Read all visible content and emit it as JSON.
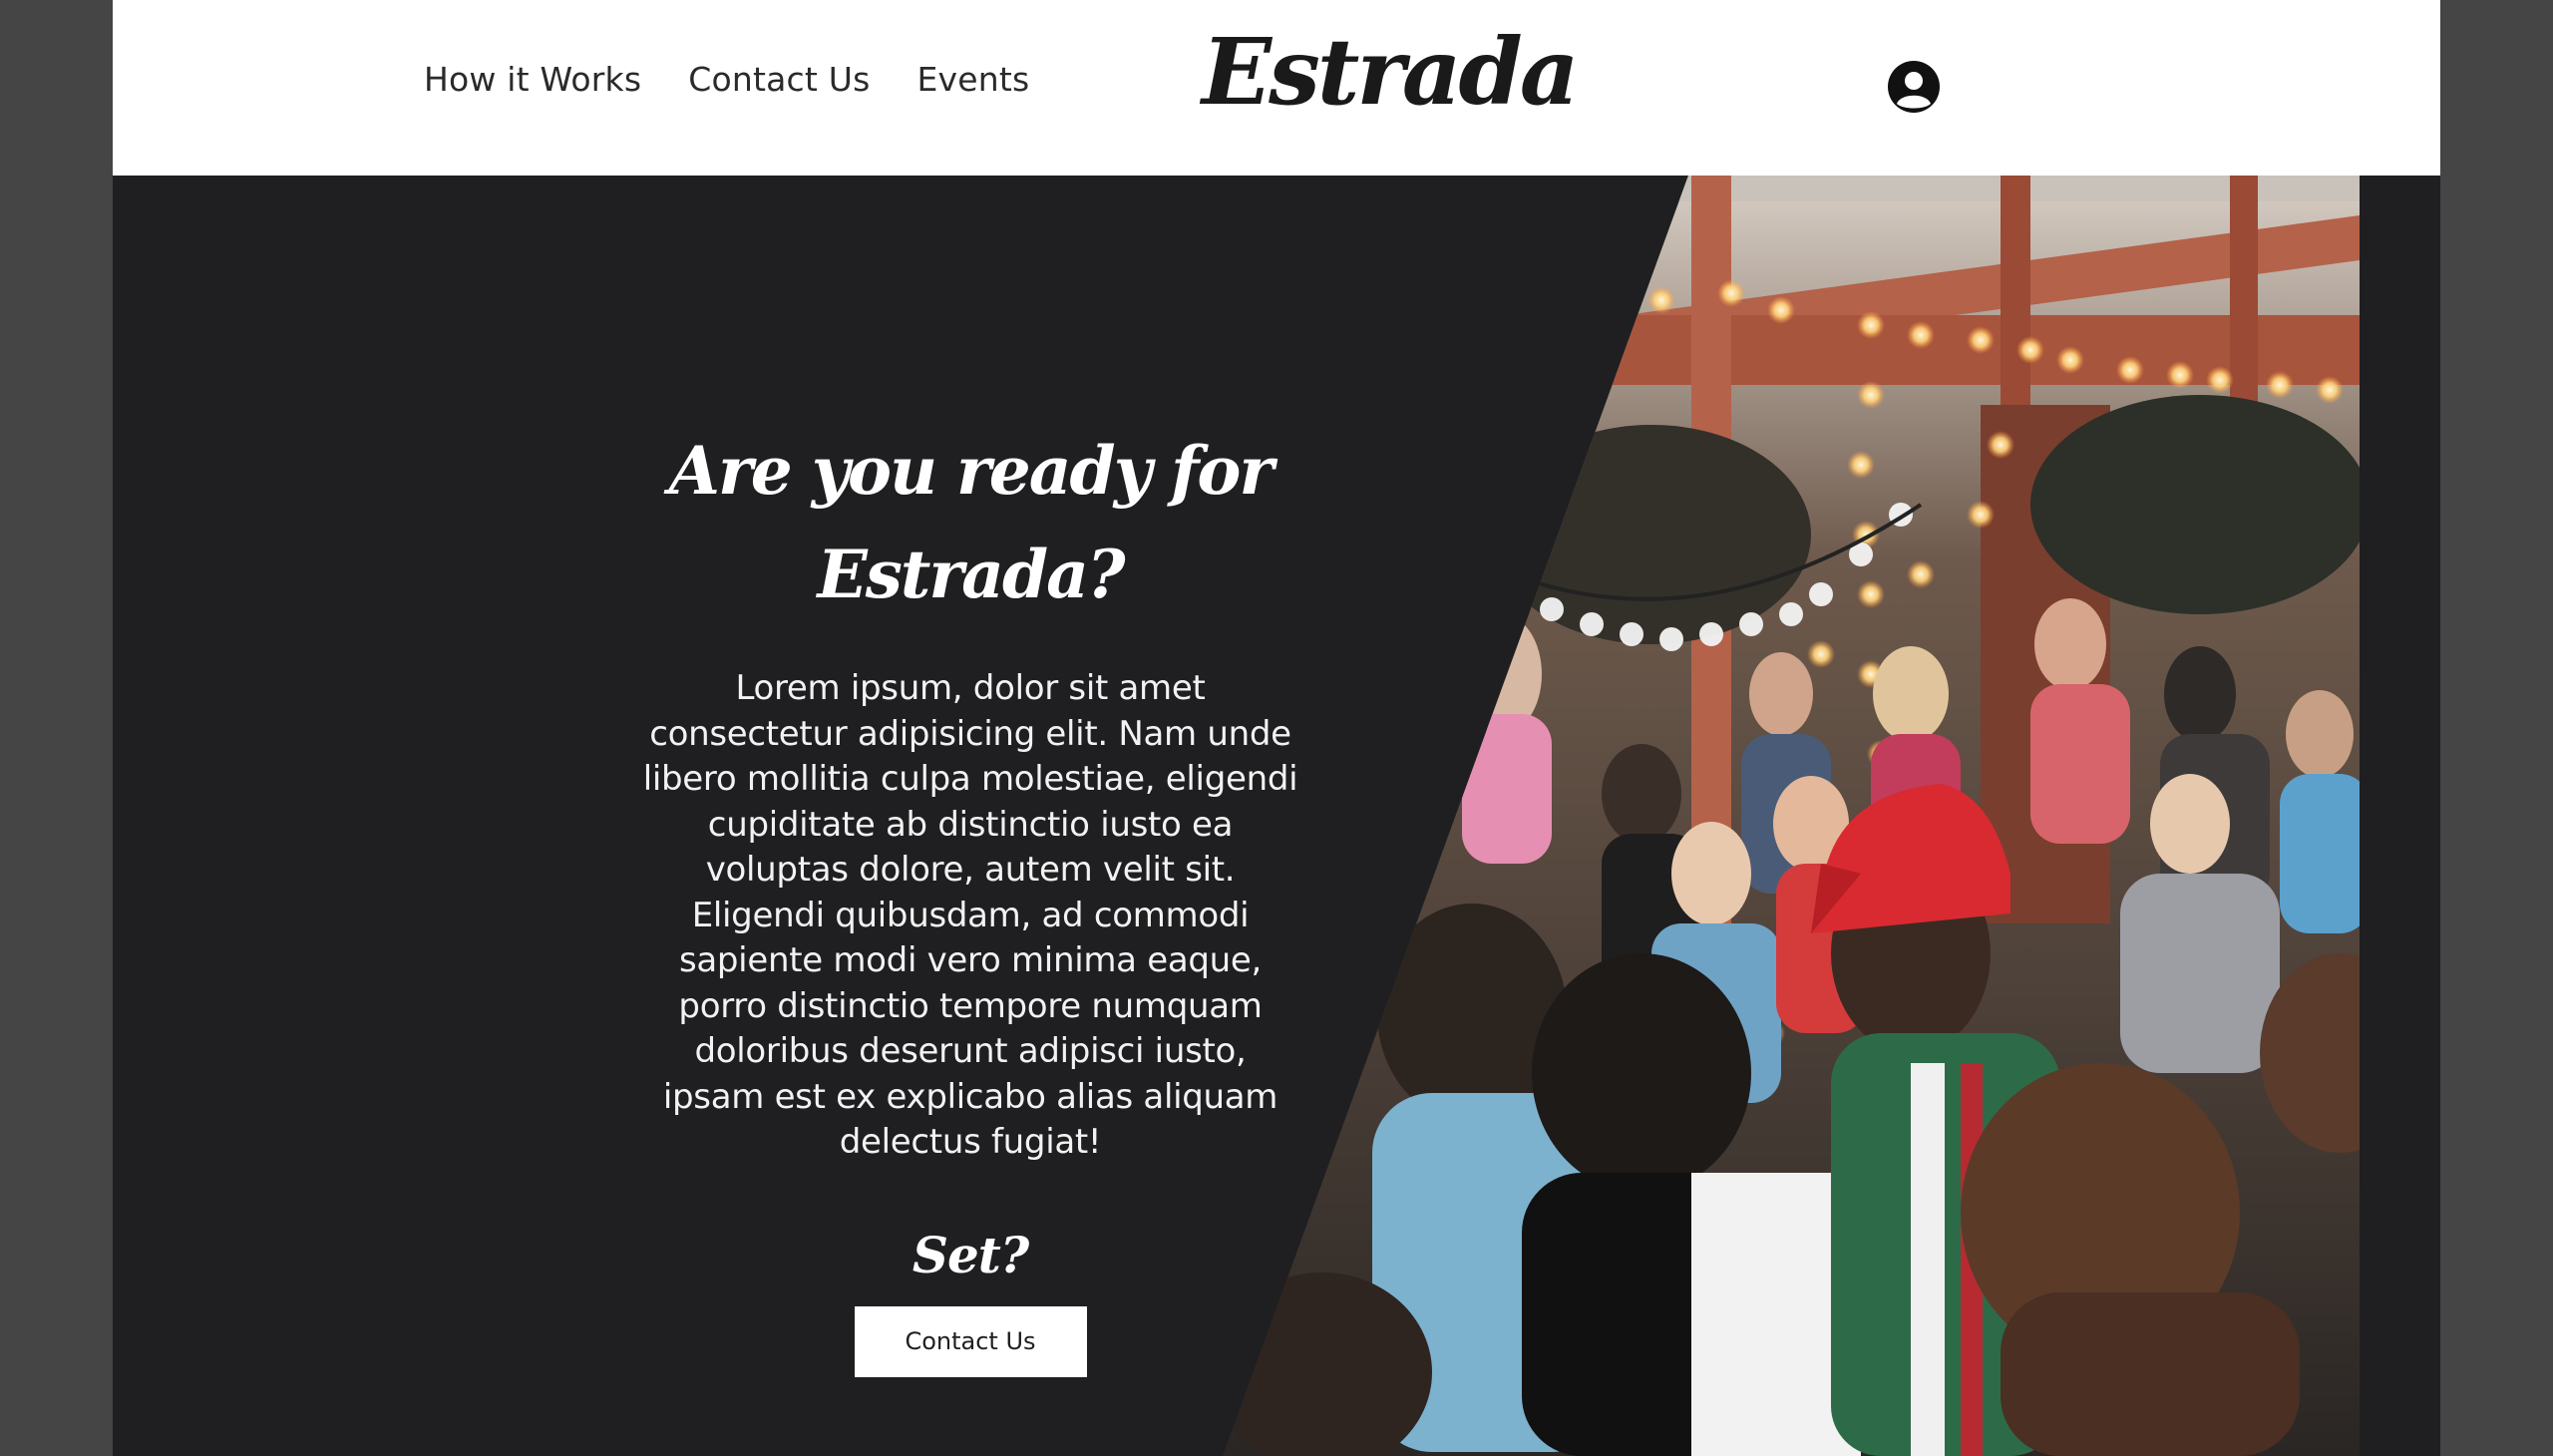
{
  "nav": {
    "items": [
      "How it Works",
      "Contact Us",
      "Events"
    ]
  },
  "brand": {
    "logo": "Estrada"
  },
  "hero": {
    "title_line1": "Are you ready for",
    "title_line2": "Estrada?",
    "body": "Lorem ipsum, dolor sit amet consectetur adipisicing elit. Nam unde libero mollitia culpa molestiae, eligendi cupiditate ab distinctio iusto ea voluptas dolore, autem velit sit. Eligendi quibusdam, ad commodi sapiente modi vero minima eaque, porro distinctio tempore numquam doloribus deserunt adipisci iusto, ipsam est ex explicabo alias aliquam delectus fugiat!",
    "set_label": "Set?",
    "cta_label": "Contact Us"
  },
  "icons": {
    "account": "user-circle-icon"
  },
  "colors": {
    "dark_panel": "#1f1f21",
    "page_bg": "#454545",
    "header_bg": "#ffffff"
  }
}
